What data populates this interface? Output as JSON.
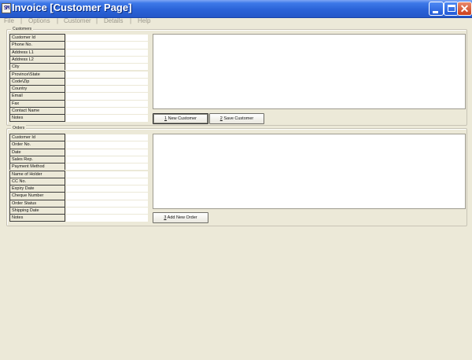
{
  "window": {
    "icon_text": "SM",
    "title": "Invoice [Customer Page]"
  },
  "menu": [
    "File",
    "Options",
    "Customer",
    "Details",
    "Help"
  ],
  "customers": {
    "legend": "Customers",
    "fields": [
      {
        "label": "Customer Id",
        "value": ""
      },
      {
        "label": "Phone No.",
        "value": ""
      },
      {
        "label": "Address L1",
        "value": ""
      },
      {
        "label": "Address L2",
        "value": ""
      },
      {
        "label": "City",
        "value": ""
      },
      {
        "label": "Province\\State",
        "value": ""
      },
      {
        "label": "Code\\Zip",
        "value": ""
      },
      {
        "label": "Country",
        "value": ""
      },
      {
        "label": "Email",
        "value": ""
      },
      {
        "label": "Fax",
        "value": ""
      },
      {
        "label": "Contact Name",
        "value": ""
      },
      {
        "label": "Notes",
        "value": ""
      }
    ],
    "buttons": {
      "new_customer": {
        "key": "1",
        "label": " New Customer"
      },
      "save_customer": {
        "key": "2",
        "label": " Save Customer"
      }
    }
  },
  "orders": {
    "legend": "Orders",
    "fields": [
      {
        "label": "Customer Id",
        "value": ""
      },
      {
        "label": "Order No.",
        "value": ""
      },
      {
        "label": "Date",
        "value": ""
      },
      {
        "label": "Sales Rep.",
        "value": ""
      },
      {
        "label": "Payment Method",
        "value": ""
      },
      {
        "label": "Name of Holder",
        "value": ""
      },
      {
        "label": "CC No.",
        "value": ""
      },
      {
        "label": "Expiry Date",
        "value": ""
      },
      {
        "label": "Cheque Number",
        "value": ""
      },
      {
        "label": "Order Status",
        "value": ""
      },
      {
        "label": "Shipping Date",
        "value": ""
      },
      {
        "label": "Notes",
        "value": ""
      }
    ],
    "buttons": {
      "add_new_order": {
        "key": "3",
        "label": " Add New Order"
      }
    }
  },
  "colors": {
    "titlebar": "#2B63D8",
    "window_bg": "#ECE9D8",
    "field_bg": "#FFFFFF"
  }
}
